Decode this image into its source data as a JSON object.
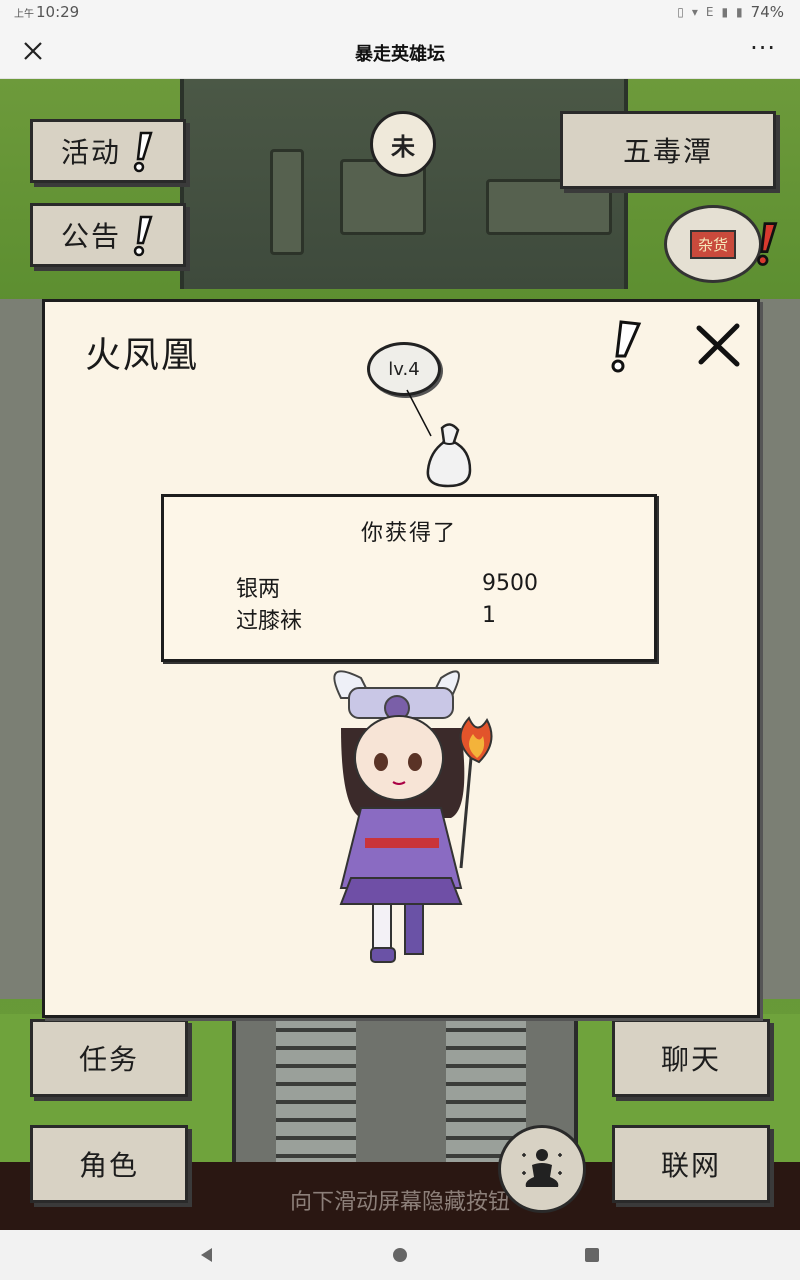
{
  "status_bar": {
    "ampm": "上午",
    "time": "10:29",
    "network": "E",
    "battery": "74%"
  },
  "top_bar": {
    "title": "暴走英雄坛",
    "more": "···"
  },
  "scene": {
    "left_buttons": {
      "activity": "活动",
      "announcement": "公告",
      "quest": "任务",
      "character": "角色"
    },
    "right_buttons": {
      "location": "五毒潭",
      "chat": "聊天",
      "network": "联网"
    },
    "sun_icon_char": "未",
    "shop_sign": "杂货",
    "hint": "向下滑动屏幕隐藏按钮"
  },
  "card": {
    "title": "火凤凰",
    "level": "lv.4",
    "reward": {
      "heading": "你获得了",
      "items": [
        {
          "name": "银两",
          "value": "9500"
        },
        {
          "name": "过膝袜",
          "value": "1"
        }
      ]
    }
  },
  "colors": {
    "paper": "#fbf4e6",
    "button": "#d8d2c4",
    "grass": "#6b9d3a",
    "alert_red": "#d83a2f"
  }
}
